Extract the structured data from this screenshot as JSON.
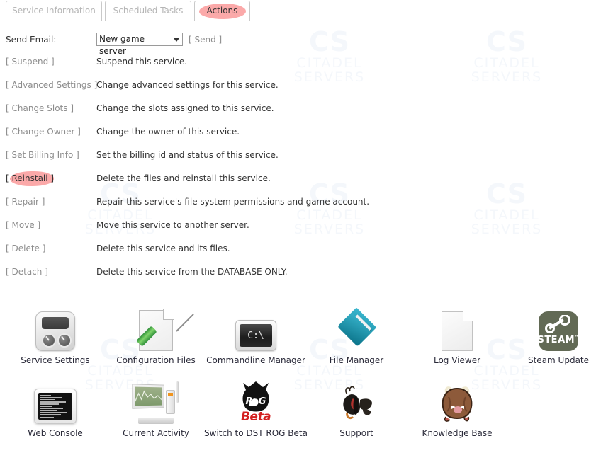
{
  "tabs": [
    {
      "label": "Service Information",
      "active": false,
      "highlighted": false
    },
    {
      "label": "Scheduled Tasks",
      "active": false,
      "highlighted": false
    },
    {
      "label": "Actions",
      "active": true,
      "highlighted": true
    }
  ],
  "email": {
    "label": "Send Email:",
    "selected_option": "New game server",
    "send_label": "[ Send ]"
  },
  "actions": [
    {
      "link": "[ Suspend ]",
      "label": "Suspend",
      "desc": "Suspend this service.",
      "highlighted": false
    },
    {
      "link": "[ Advanced Settings ]",
      "label": "Advanced Settings",
      "desc": "Change advanced settings for this service.",
      "highlighted": false
    },
    {
      "link": "[ Change Slots ]",
      "label": "Change Slots",
      "desc": "Change the slots assigned to this service.",
      "highlighted": false
    },
    {
      "link": "[ Change Owner ]",
      "label": "Change Owner",
      "desc": "Change the owner of this service.",
      "highlighted": false
    },
    {
      "link": "[ Set Billing Info ]",
      "label": "Set Billing Info",
      "desc": "Set the billing id and status of this service.",
      "highlighted": false
    },
    {
      "link": "[ Reinstall ]",
      "label": "Reinstall",
      "desc": "Delete the files and reinstall this service.",
      "highlighted": true
    },
    {
      "link": "[ Repair ]",
      "label": "Repair",
      "desc": "Repair this service's file system permissions and game account.",
      "highlighted": false
    },
    {
      "link": "[ Move ]",
      "label": "Move",
      "desc": "Move this service to another server.",
      "highlighted": false
    },
    {
      "link": "[ Delete ]",
      "label": "Delete",
      "desc": "Delete this service and its files.",
      "highlighted": false
    },
    {
      "link": "[ Detach ]",
      "label": "Detach",
      "desc": "Delete this service from the DATABASE ONLY.",
      "highlighted": false
    }
  ],
  "icons": {
    "row1": [
      {
        "label": "Service Settings",
        "icon": "service-settings-icon"
      },
      {
        "label": "Configuration Files",
        "icon": "configuration-files-icon"
      },
      {
        "label": "Commandline Manager",
        "icon": "commandline-manager-icon",
        "terminal_text": "C:\\"
      },
      {
        "label": "File Manager",
        "icon": "file-manager-icon"
      },
      {
        "label": "Log Viewer",
        "icon": "log-viewer-icon"
      },
      {
        "label": "Steam Update",
        "icon": "steam-update-icon",
        "badge_text": "STEAM"
      }
    ],
    "row2": [
      {
        "label": "Web Console",
        "icon": "web-console-icon"
      },
      {
        "label": "Current Activity",
        "icon": "current-activity-icon"
      },
      {
        "label": "Switch to DST ROG Beta",
        "icon": "dst-rog-beta-icon",
        "badge_text": "Beta"
      },
      {
        "label": "Support",
        "icon": "support-icon"
      },
      {
        "label": "Knowledge Base",
        "icon": "knowledge-base-icon"
      }
    ]
  },
  "watermark": {
    "cs": "CS",
    "line1": "CITADEL",
    "line2": "SERVERS"
  },
  "colors": {
    "highlight": "#f98c8c",
    "link": "#8d8d8d",
    "text": "#333333",
    "watermark": "#f4f7fb",
    "steam_bg": "#626a55",
    "folder_teal": "#0d7f97",
    "beta_red": "#d31f1f"
  }
}
